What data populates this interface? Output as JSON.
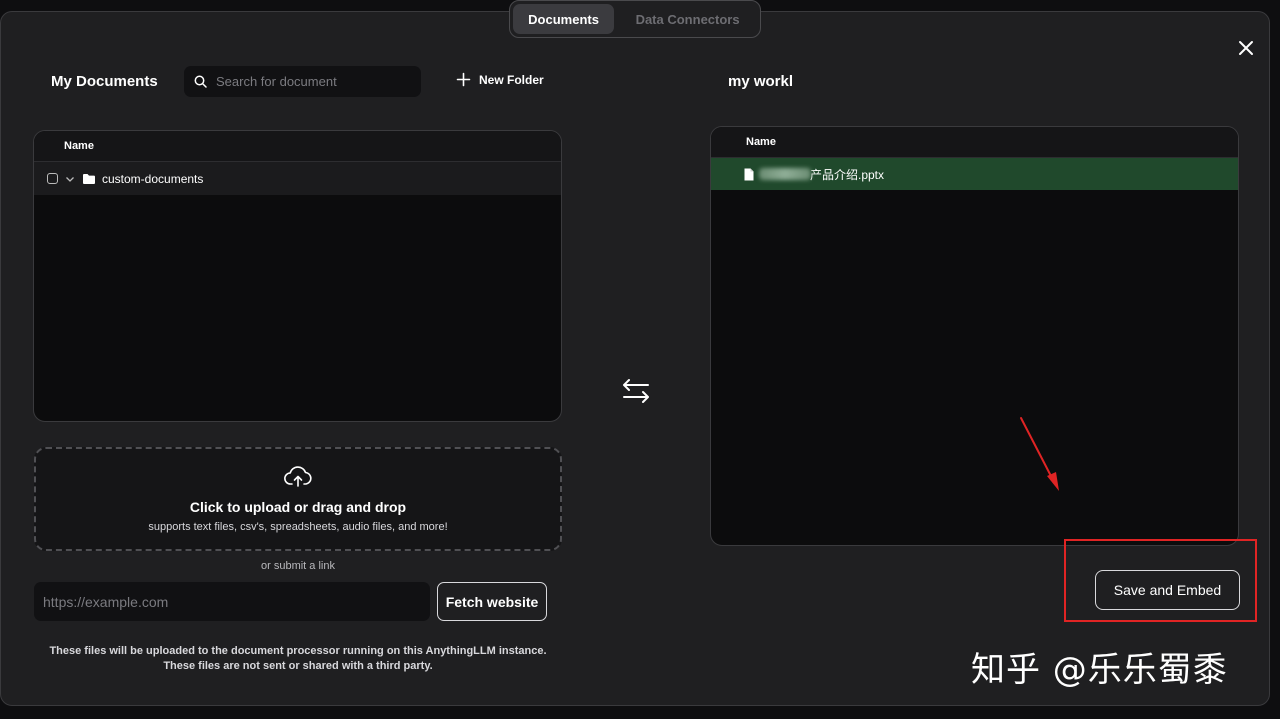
{
  "tabs": [
    {
      "label": "Documents",
      "active": true
    },
    {
      "label": "Data Connectors",
      "active": false
    }
  ],
  "my_documents": {
    "title": "My Documents",
    "search_placeholder": "Search for document",
    "new_folder_label": "New Folder",
    "column_name": "Name",
    "folders": [
      {
        "name": "custom-documents",
        "checked": false,
        "expanded": true
      }
    ]
  },
  "upload": {
    "title": "Click to upload or drag and drop",
    "subtitle": "supports text files, csv's, spreadsheets, audio files, and more!",
    "or_link": "or submit a link",
    "url_placeholder": "https://example.com",
    "fetch_label": "Fetch website",
    "notice_line1": "These files will be uploaded to the document processor running on this AnythingLLM instance.",
    "notice_line2": "These files are not sent or shared with a third party."
  },
  "workspace": {
    "title": "my workl",
    "column_name": "Name",
    "files": [
      {
        "name": "产品介绍.pptx",
        "visible_suffix": "产品介绍.pptx"
      }
    ],
    "save_label": "Save and Embed"
  },
  "watermark": "知乎 @乐乐蜀黍",
  "icons": {
    "close": "close-icon",
    "search": "search-icon",
    "plus": "plus-icon",
    "folder": "folder-icon",
    "chevron": "chevron-down-icon",
    "file": "file-icon",
    "cloud_upload": "cloud-upload-icon",
    "swap": "swap-arrows-icon"
  },
  "colors": {
    "modal_bg": "#1f1f21",
    "selected_row": "#20492c",
    "highlight": "#e02424"
  }
}
